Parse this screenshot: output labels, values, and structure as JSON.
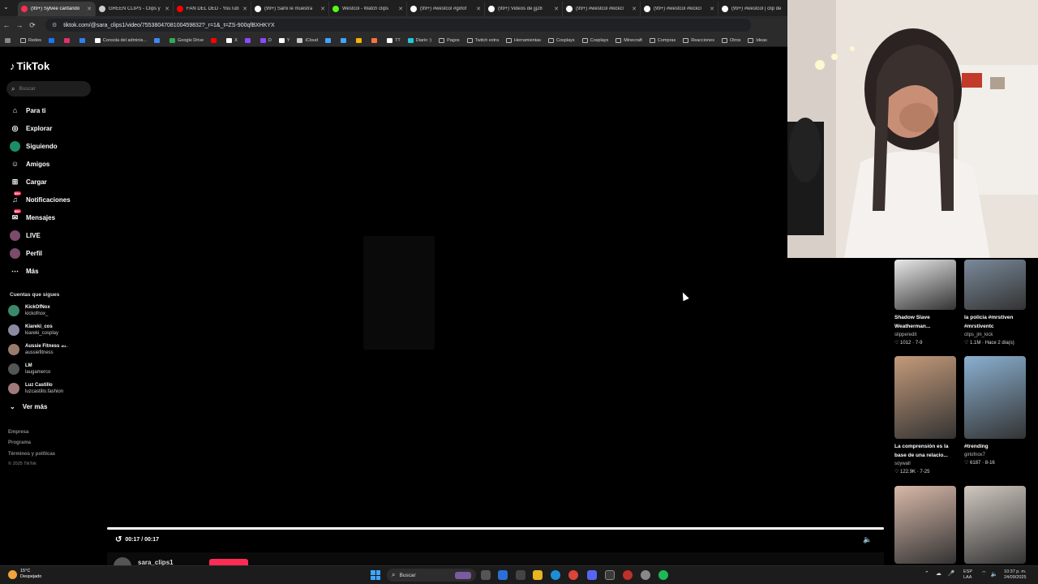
{
  "browser": {
    "tabs": [
      {
        "label": "(99+) Sylvee cantando",
        "color": "#fe2c55",
        "active": true
      },
      {
        "label": "GREEN CLIPS - Clips y",
        "color": "#cccccc",
        "active": false
      },
      {
        "label": "FAN DEL DED - YouTub",
        "color": "#ff0000",
        "active": false
      },
      {
        "label": "(99+) Sami le muestra",
        "color": "#ffffff",
        "active": false
      },
      {
        "label": "Westcol - Watch clips",
        "color": "#53fc18",
        "active": false
      },
      {
        "label": "(99+) #westcol #girlof",
        "color": "#ffffff",
        "active": false
      },
      {
        "label": "(99+) Videos de jjj28",
        "color": "#ffffff",
        "active": false
      },
      {
        "label": "(99+) #westcol #kickcl",
        "color": "#ffffff",
        "active": false
      },
      {
        "label": "(99+) #westcol #kickcl",
        "color": "#ffffff",
        "active": false
      },
      {
        "label": "(99+) #westcol | clip de",
        "color": "#ffffff",
        "active": false
      }
    ],
    "url": "tiktok.com/@sara_clips1/video/7553804708100459832?_r=1&_t=ZS-900qfBXHKYX",
    "bookmarks": [
      {
        "label": "Redes",
        "folder": true,
        "color": "#cccccc"
      },
      {
        "label": "",
        "folder": false,
        "color": "#1877f2"
      },
      {
        "label": "",
        "folder": false,
        "color": "#e1306c"
      },
      {
        "label": "",
        "folder": false,
        "color": "#2f80ed"
      },
      {
        "label": "Consola del adminis...",
        "folder": false,
        "color": "#ffffff"
      },
      {
        "label": "",
        "folder": false,
        "color": "#4285f4"
      },
      {
        "label": "Google Drive",
        "folder": false,
        "color": "#34a853"
      },
      {
        "label": "",
        "folder": false,
        "color": "#ff0000"
      },
      {
        "label": "X",
        "folder": false,
        "color": "#ffffff"
      },
      {
        "label": "",
        "folder": false,
        "color": "#9146ff"
      },
      {
        "label": "D",
        "folder": false,
        "color": "#9146ff"
      },
      {
        "label": "Y",
        "folder": false,
        "color": "#ffffff"
      },
      {
        "label": "iCloud",
        "folder": false,
        "color": "#cccccc"
      },
      {
        "label": "",
        "folder": false,
        "color": "#3ea6ff"
      },
      {
        "label": "",
        "folder": false,
        "color": "#3ea6ff"
      },
      {
        "label": "",
        "folder": false,
        "color": "#f4b400"
      },
      {
        "label": "",
        "folder": false,
        "color": "#ff7043"
      },
      {
        "label": "TT",
        "folder": false,
        "color": "#ffffff"
      },
      {
        "label": "Diario :)",
        "folder": false,
        "color": "#26c6da"
      },
      {
        "label": "Pagos",
        "folder": true,
        "color": "#cccccc"
      },
      {
        "label": "Twitch extra",
        "folder": true,
        "color": "#cccccc"
      },
      {
        "label": "Herramientas",
        "folder": true,
        "color": "#cccccc"
      },
      {
        "label": "Cosplays",
        "folder": true,
        "color": "#cccccc"
      },
      {
        "label": "Cosplays",
        "folder": true,
        "color": "#cccccc"
      },
      {
        "label": "Minecraft",
        "folder": true,
        "color": "#cccccc"
      },
      {
        "label": "Compras",
        "folder": true,
        "color": "#cccccc"
      },
      {
        "label": "Reacciones",
        "folder": true,
        "color": "#cccccc"
      },
      {
        "label": "Otros",
        "folder": true,
        "color": "#cccccc"
      },
      {
        "label": "Ideas",
        "folder": true,
        "color": "#cccccc"
      }
    ]
  },
  "tiktok": {
    "logo": "TikTok",
    "search_placeholder": "Buscar",
    "nav": [
      {
        "label": "Para ti",
        "icon": "home-icon",
        "glyph": "⌂",
        "badge": ""
      },
      {
        "label": "Explorar",
        "icon": "compass-icon",
        "glyph": "◎",
        "badge": ""
      },
      {
        "label": "Siguiendo",
        "icon": "following-avatar-icon",
        "glyph": "",
        "badge": ""
      },
      {
        "label": "Amigos",
        "icon": "friends-icon",
        "glyph": "☺",
        "badge": ""
      },
      {
        "label": "Cargar",
        "icon": "upload-icon",
        "glyph": "⊞",
        "badge": ""
      },
      {
        "label": "Notificaciones",
        "icon": "bell-icon",
        "glyph": "♫",
        "badge": "99+"
      },
      {
        "label": "Mensajes",
        "icon": "message-icon",
        "glyph": "✉",
        "badge": "99+"
      },
      {
        "label": "LIVE",
        "icon": "live-icon",
        "glyph": "",
        "badge": ""
      },
      {
        "label": "Perfil",
        "icon": "profile-icon",
        "glyph": "",
        "badge": ""
      },
      {
        "label": "Más",
        "icon": "more-icon",
        "glyph": "⋯",
        "badge": ""
      }
    ],
    "following_title": "Cuentas que sigues",
    "accounts": [
      {
        "name": "KickOfNox",
        "handle": "kickofnox_",
        "color": "#3a8a6a"
      },
      {
        "name": "Kiareki_cos",
        "handle": "kiareki_cosplay",
        "color": "#8a8aa0"
      },
      {
        "name": "Aussie Fitness",
        "name_suffix": "AU...",
        "handle": "aussiefitness",
        "color": "#9a7a6a"
      },
      {
        "name": "LM",
        "handle": "laugamerco",
        "color": "#555555"
      },
      {
        "name": "Luz Castillo",
        "handle": "luzcastillo.fashion",
        "color": "#a07a7a"
      }
    ],
    "see_more": "Ver más",
    "footer": [
      "Empresa",
      "Programa",
      "Términos y políticas",
      "© 2025 TikTok"
    ]
  },
  "video": {
    "time": "00:17 / 00:17",
    "progress": 1.0,
    "username": "sara_clips1"
  },
  "recommendations": [
    {
      "caption": "Shadow Slave Weatherman...",
      "author": "slipperedit",
      "likes": "1012",
      "date": "7-9",
      "color": "#e8e8e8"
    },
    {
      "caption": "la policia #mrstiven #mrstiventc",
      "author": "clips_jm_kick",
      "likes": "1.1M",
      "date": "Hace 2 día(s)",
      "color": "#7a8a9a"
    },
    {
      "caption": "La comprensión es la base de una relacio...",
      "author": "soywall",
      "likes": "122.9K",
      "date": "7-25",
      "color": "#c49a7a"
    },
    {
      "caption": "#trending",
      "author": "girlofnox7",
      "likes": "6187",
      "date": "8-16",
      "color": "#8ab0d0"
    },
    {
      "caption": "",
      "author": "",
      "likes": "",
      "date": "",
      "color": "#d8b8a8"
    },
    {
      "caption": "",
      "author": "",
      "likes": "",
      "date": "",
      "color": "#d0c8c0"
    }
  ],
  "taskbar": {
    "weather_temp": "15°C",
    "weather_desc": "Despejado",
    "search_label": "Buscar",
    "lang_top": "ESP",
    "lang_bottom": "LAA",
    "time": "10:37 p. m.",
    "date": "24/09/2025"
  }
}
